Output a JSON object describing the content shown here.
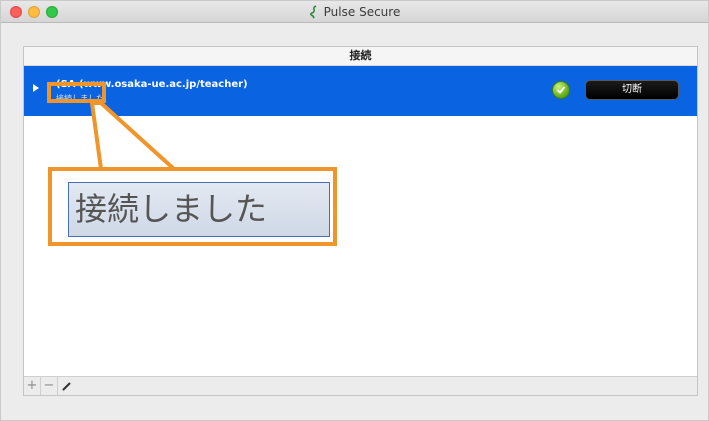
{
  "window": {
    "title": "Pulse Secure",
    "title_icon": "pulse-secure-logo-icon"
  },
  "panel": {
    "header": "接続"
  },
  "connection": {
    "name": "(SA (www.osaka-ue.ac.jp/teacher)",
    "status": "接続しました",
    "status_icon": "connected-check-icon",
    "disconnect_label": "切断"
  },
  "footer": {
    "add_label": "+",
    "remove_label": "−",
    "edit_icon": "pencil-icon"
  },
  "callout": {
    "zoom_text": "接続しました",
    "color": "#f0952a"
  },
  "colors": {
    "selection": "#0a63e0",
    "accent": "#f0952a"
  }
}
